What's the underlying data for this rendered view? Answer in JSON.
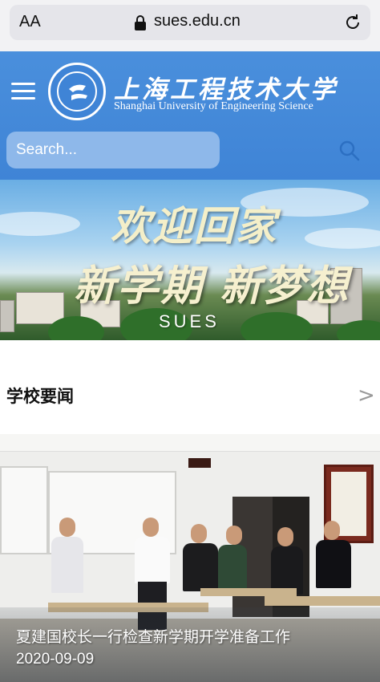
{
  "browser": {
    "text_size_label": "AA",
    "url": "sues.edu.cn"
  },
  "header": {
    "name_cn": "上海工程技术大学",
    "name_en": "Shanghai University of Engineering Science"
  },
  "search": {
    "placeholder": "Search..."
  },
  "banner": {
    "welcome": "欢迎回家",
    "slogan": "新学期 新梦想",
    "mark": "SUES"
  },
  "section": {
    "title": "学校要闻",
    "more": ">"
  },
  "news": {
    "title": "夏建国校长一行检查新学期开学准备工作",
    "date": "2020-09-09"
  },
  "colors": {
    "header_blue": "#3f84d6",
    "search_bg": "#8eb8ea"
  }
}
